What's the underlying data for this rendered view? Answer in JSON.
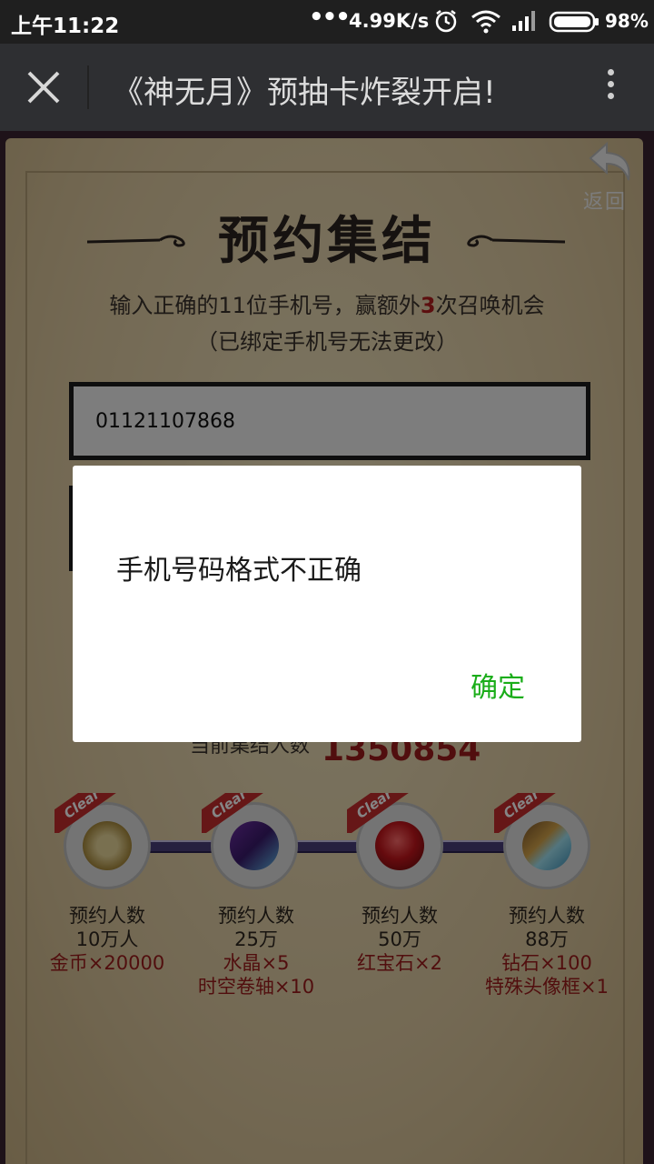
{
  "status_bar": {
    "time": "上午11:22",
    "dots": "•••",
    "net_speed": "4.99K/s",
    "battery": "98%",
    "icons": [
      "alarm-icon",
      "wifi-icon",
      "signal-icon",
      "battery-icon"
    ]
  },
  "title_bar": {
    "title": "《神无月》预抽卡炸裂开启!",
    "icons": [
      "close-icon",
      "more-vertical-icon"
    ]
  },
  "page": {
    "back_label": "返回",
    "heading": "预约集结",
    "subtitle_prefix": "输入正确的11位手机号，赢额外",
    "subtitle_number": "3",
    "subtitle_suffix": "次召唤机会",
    "subtitle_note": "（已绑定手机号无法更改）",
    "phone_value": "01121107868",
    "count_label": "当前集结人数",
    "count_value": "1350854",
    "badge_label": "Clear",
    "tiers": [
      {
        "title": "预约人数",
        "amount": "10万人",
        "reward_1": "金币×20000",
        "reward_2": ""
      },
      {
        "title": "预约人数",
        "amount": "25万",
        "reward_1": "水晶×5",
        "reward_2": "时空卷轴×10"
      },
      {
        "title": "预约人数",
        "amount": "50万",
        "reward_1": "红宝石×2",
        "reward_2": ""
      },
      {
        "title": "预约人数",
        "amount": "88万",
        "reward_1": "钻石×100",
        "reward_2": "特殊头像框×1"
      }
    ]
  },
  "dialog": {
    "message": "手机号码格式不正确",
    "ok_label": "确定"
  },
  "colors": {
    "accent_green": "#1aad19",
    "reward_red": "#9c1c1c",
    "title_bar": "#2e2f32",
    "status_bar": "#1f1f1f"
  }
}
